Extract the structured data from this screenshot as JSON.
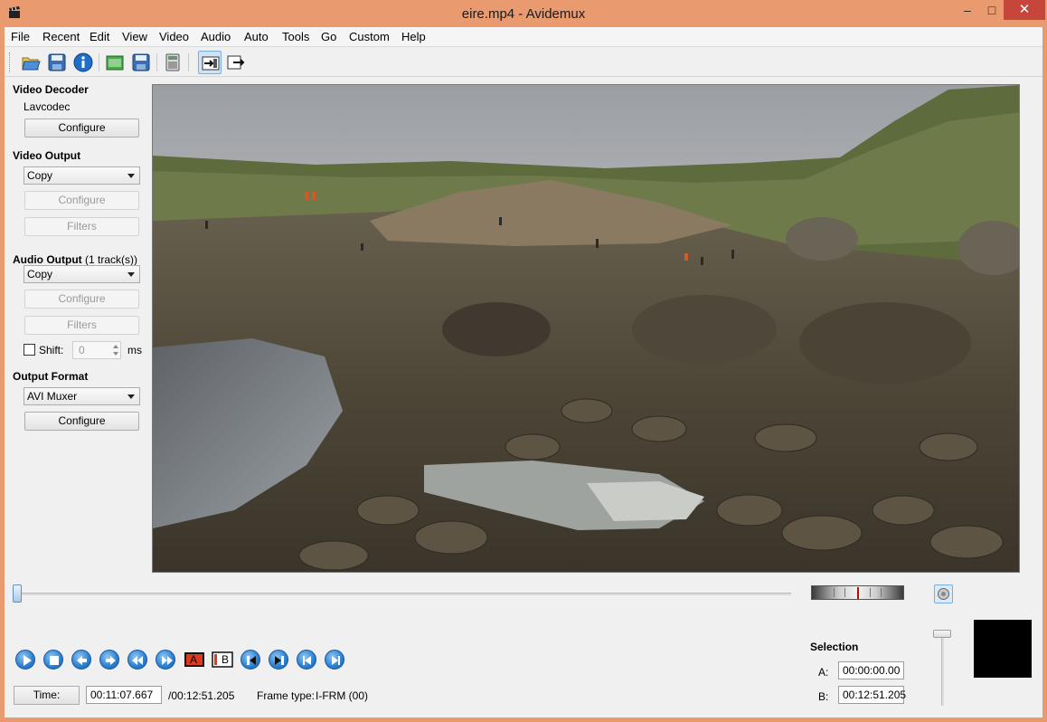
{
  "window": {
    "title": "eire.mp4 - Avidemux",
    "min": "‒",
    "max": "□",
    "close": "✕"
  },
  "menu": [
    "File",
    "Recent",
    "Edit",
    "View",
    "Video",
    "Audio",
    "Auto",
    "Tools",
    "Go",
    "Custom",
    "Help"
  ],
  "toolbar": {
    "icons": [
      "open-icon",
      "save-icon",
      "info-icon",
      "open-append-icon",
      "save-as-icon",
      "calculator-icon",
      "input-mode-icon",
      "output-mode-icon"
    ]
  },
  "left_panel": {
    "video_decoder": {
      "title": "Video Decoder",
      "codec": "Lavcodec",
      "configure": "Configure"
    },
    "video_output": {
      "title": "Video Output",
      "selected": "Copy",
      "configure": "Configure",
      "filters": "Filters"
    },
    "audio_output": {
      "title": "Audio Output",
      "tracks": "(1 track(s))",
      "selected": "Copy",
      "configure": "Configure",
      "filters": "Filters",
      "shift_label": "Shift:",
      "shift_value": "0",
      "shift_unit": "ms",
      "shift_checked": false
    },
    "output_format": {
      "title": "Output Format",
      "selected": "AVI Muxer",
      "configure": "Configure"
    }
  },
  "playback": {
    "buttons": [
      "play-icon",
      "stop-icon",
      "prev-frame-icon",
      "next-frame-icon",
      "prev-keyframe-icon",
      "next-keyframe-icon",
      "set-marker-a-icon",
      "set-marker-b-icon",
      "prev-black-icon",
      "next-black-icon",
      "goto-start-icon",
      "goto-end-icon"
    ],
    "marker_a": "A",
    "marker_b": "B",
    "seek_position": 0.0
  },
  "status": {
    "time_button": "Time:",
    "current_time": "00:11:07.667",
    "total_time": "/00:12:51.205",
    "frame_type_label": "Frame type:",
    "frame_type_value": "I-FRM (00)"
  },
  "selection": {
    "title": "Selection",
    "a_label": "A:",
    "a_value": "00:00:00.00",
    "b_label": "B:",
    "b_value": "00:12:51.205"
  },
  "colors": {
    "window_frame": "#e99b6f",
    "close_button": "#c7463b",
    "accent": "#2a7fcf"
  }
}
